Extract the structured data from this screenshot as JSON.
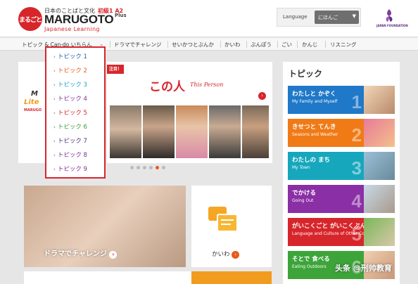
{
  "header": {
    "logo_text": "まるごと",
    "tagline": "日本のことばと文化",
    "level": "初級1 A2",
    "brand": "MARUGOTO",
    "brand_plus": "Plus",
    "subtitle": "Japanese Learning",
    "language_label": "Language",
    "language_value": "にほんご",
    "foundation_logo": "JAPAN FOUNDATION"
  },
  "nav": {
    "items": [
      "トピック & Can-do いちらん",
      "ドラマでチャレンジ",
      "せいかつとぶんか",
      "かいわ",
      "ぶんぽう",
      "ごい",
      "かんじ",
      "リスニング"
    ]
  },
  "dropdown": {
    "items": [
      {
        "label": "トピック 1",
        "color": "#1f5fa8"
      },
      {
        "label": "トピック 2",
        "color": "#e8591a"
      },
      {
        "label": "トピック 3",
        "color": "#1aa2c8"
      },
      {
        "label": "トピック 4",
        "color": "#7b2b94"
      },
      {
        "label": "トピック 5",
        "color": "#d7262b"
      },
      {
        "label": "トピック 6",
        "color": "#3a9a3a"
      },
      {
        "label": "トピック 7",
        "color": "#4a2f72"
      },
      {
        "label": "トピック 8",
        "color": "#7b2b94"
      },
      {
        "label": "トピック 9",
        "color": "#7b2b94"
      }
    ]
  },
  "banner": {
    "badge": "注目！",
    "title_jp": "この人",
    "title_en": "This Person"
  },
  "left_banner": {
    "line1": "M",
    "line2": "Lite",
    "line3": "MARUGO"
  },
  "topics": {
    "heading": "トピック",
    "items": [
      {
        "jp": "わたしと かぞく",
        "en": "My Family and Myself",
        "num": "1",
        "color": "#1f78c8"
      },
      {
        "jp": "きせつと てんき",
        "en": "Seasons and Weather",
        "num": "2",
        "color": "#f07a16"
      },
      {
        "jp": "わたしの まち",
        "en": "My Town",
        "num": "3",
        "color": "#17a7bd"
      },
      {
        "jp": "でかける",
        "en": "Going Out",
        "num": "4",
        "color": "#8a2fa5"
      },
      {
        "jp": "がいこくごと がいこくぶんか",
        "en": "Language and Culture of Other Countries",
        "num": "5",
        "color": "#d7262b"
      },
      {
        "jp": "そとで 食べる",
        "en": "Eating Outdoors",
        "num": "6",
        "color": "#3da43a"
      }
    ]
  },
  "tiles": {
    "drama_label": "ドラマでチャレンジ",
    "kaiwa_label": "かいわ"
  },
  "watermark": "头条 @刑帅教育"
}
